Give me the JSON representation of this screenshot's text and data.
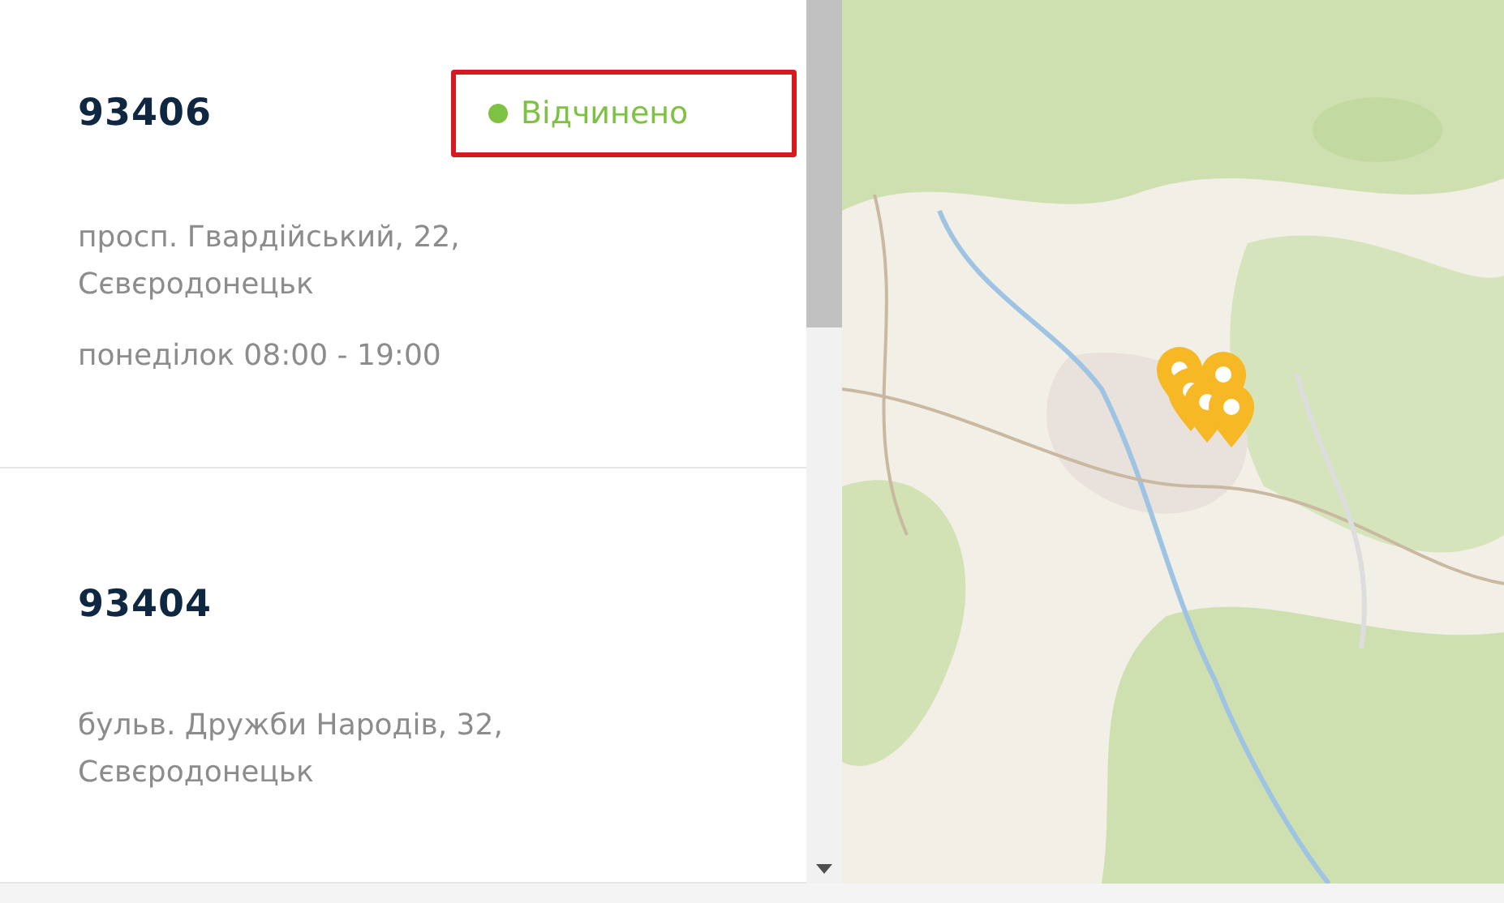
{
  "offices": [
    {
      "number": "93406",
      "status": {
        "label": "Відчинено",
        "open": true,
        "highlighted": true
      },
      "address_lines": [
        "просп. Гвардійський, 22,",
        "Сєвєродонецьк"
      ],
      "hours": "понеділок 08:00 - 19:00"
    },
    {
      "number": "93404",
      "address_lines": [
        "бульв. Дружби Народів, 32,",
        "Сєвєродонецьк"
      ]
    }
  ]
}
